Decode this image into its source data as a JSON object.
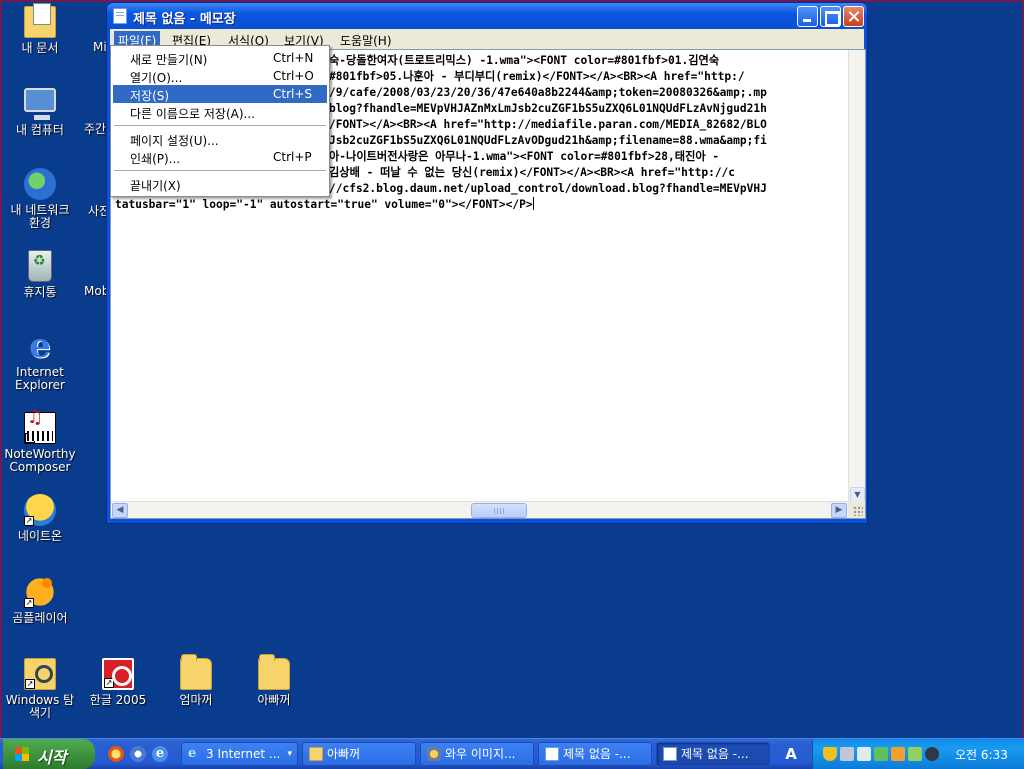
{
  "desktop": {
    "icons": [
      {
        "label": "내 문서"
      },
      {
        "label": "내 컴퓨터"
      },
      {
        "label": "내 네트워크 환경"
      },
      {
        "label": "휴지통"
      },
      {
        "label": "Internet Explorer"
      },
      {
        "label": "NoteWorthy Composer"
      },
      {
        "label": "네이트온"
      },
      {
        "label": "곰플레이어"
      },
      {
        "label": "Windows 탐색기"
      },
      {
        "label": "한글 2005"
      },
      {
        "label": "엄마꺼"
      },
      {
        "label": "아빠꺼"
      }
    ],
    "partial_labels": [
      "Mi",
      "주간",
      "사진",
      "Mob"
    ]
  },
  "window": {
    "title": "제목 없음 - 메모장",
    "menu": [
      "파일(F)",
      "편집(E)",
      "서식(O)",
      "보기(V)",
      "도움말(H)"
    ],
    "text_lines": [
      "숙-당돌한여자(트로트리믹스) -1.wma\"><FONT color=#801fbf>01.김연숙",
      "#801fbf>05.나훈아 - 부디부디(remix)</FONT></A><BR><A href=\"http:/",
      "/9/cafe/2008/03/23/20/36/47e640a8b2244&amp;token=20080326&amp;.mp",
      "blog?fhandle=MEVpVHJAZnMxLmJsb2cuZGF1bS5uZXQ6L01NQUdFLzAvNjgud21h",
      "/FONT></A><BR><A href=\"http://mediafile.paran.com/MEDIA_82682/BLO",
      "Jsb2cuZGF1bS5uZXQ6L01NQUdFLzAvODgud21h&amp;filename=88.wma&amp;fi",
      "아-나이트버전사랑은 아무나-1.wma\"><FONT color=#801fbf>28,태진아 -",
      "김상배 - 떠날 수 없는 당신(remix)</FONT></A><BR><A href=\"http://c",
      "//cfs2.blog.daum.net/upload_control/download.blog?fhandle=MEVpVHJ",
      "tatusbar=\"1\" loop=\"-1\" autostart=\"true\" volume=\"0\"></FONT></P>"
    ]
  },
  "file_menu": {
    "items": [
      {
        "label": "새로 만들기(N)",
        "shortcut": "Ctrl+N"
      },
      {
        "label": "열기(O)...",
        "shortcut": "Ctrl+O"
      },
      {
        "label": "저장(S)",
        "shortcut": "Ctrl+S"
      },
      {
        "label": "다른 이름으로 저장(A)...",
        "shortcut": ""
      },
      {
        "label": "페이지 설정(U)...",
        "shortcut": ""
      },
      {
        "label": "인쇄(P)...",
        "shortcut": "Ctrl+P"
      },
      {
        "label": "끝내기(X)",
        "shortcut": ""
      }
    ],
    "highlighted": "저장(S)"
  },
  "taskbar": {
    "start_label": "시작",
    "buttons": [
      {
        "label": "3 Internet ..."
      },
      {
        "label": "아빠꺼"
      },
      {
        "label": "와우 이미지..."
      },
      {
        "label": "제목 없음 -..."
      },
      {
        "label": "제목 없음 -..."
      }
    ],
    "language": "A",
    "clock": "오전 6:33"
  },
  "colors": {
    "desktop_bg": "#0a3c8e",
    "title_blue": "#0b56e0",
    "menu_highlight": "#316ac5",
    "start_green": "#3c8f3c"
  }
}
